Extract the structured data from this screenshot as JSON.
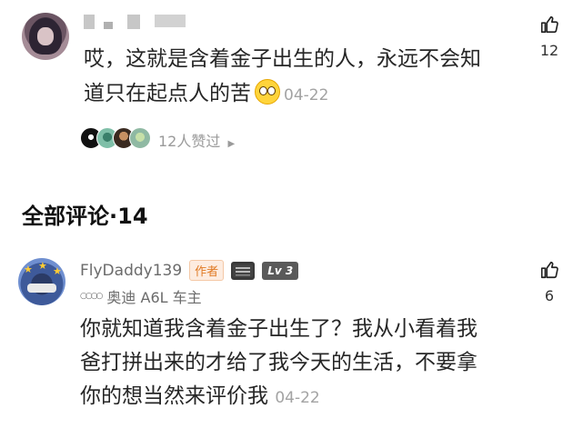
{
  "top_comment": {
    "text_line1": "哎，这就是含着金子出生的人，永远不会知",
    "text_line2": "道只在起点人的苦",
    "date": "04-22",
    "likes": "12",
    "likers_text": "12人赞过",
    "likers_arrow": "▶"
  },
  "section": {
    "title": "全部评论·14"
  },
  "reply": {
    "username": "FlyDaddy139",
    "author_badge": "作者",
    "level_badge": "Lv 3",
    "car_owner": "奥迪 A6L 车主",
    "audi_rings": "○○○○",
    "text_line1": "你就知道我含着金子出生了？我从小看着我",
    "text_line2": "爸打拼出来的才给了我今天的生活，不要拿",
    "text_line3": "你的想当然来评价我",
    "date": "04-22",
    "likes": "6"
  }
}
